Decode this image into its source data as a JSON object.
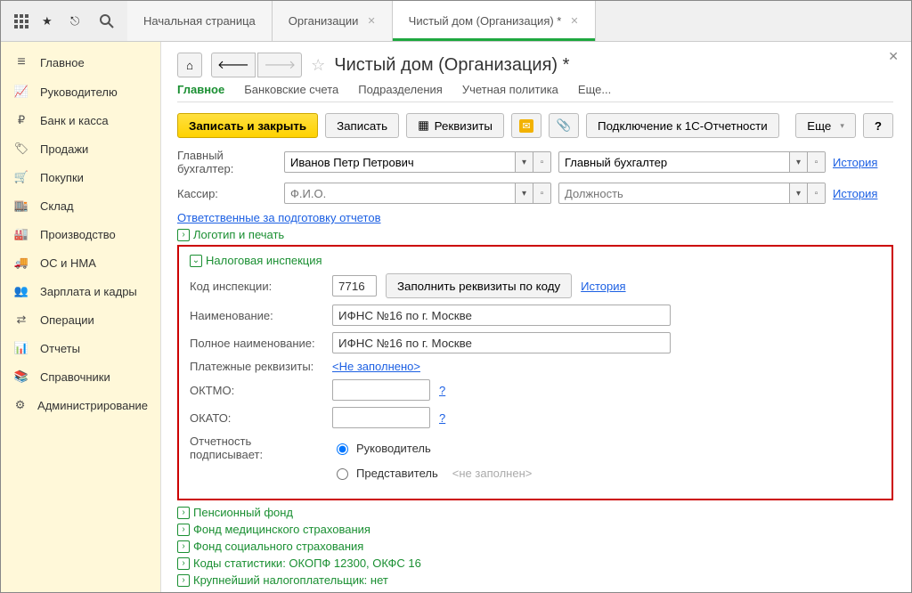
{
  "topTabs": [
    "Начальная страница",
    "Организации",
    "Чистый дом (Организация) *"
  ],
  "sidebar": [
    {
      "icon": "≡",
      "label": "Главное"
    },
    {
      "icon": "📈",
      "label": "Руководителю"
    },
    {
      "icon": "₽",
      "label": "Банк и касса"
    },
    {
      "icon": "🏷",
      "label": "Продажи"
    },
    {
      "icon": "🛒",
      "label": "Покупки"
    },
    {
      "icon": "🏬",
      "label": "Склад"
    },
    {
      "icon": "🏭",
      "label": "Производство"
    },
    {
      "icon": "🚚",
      "label": "ОС и НМА"
    },
    {
      "icon": "👥",
      "label": "Зарплата и кадры"
    },
    {
      "icon": "⇄",
      "label": "Операции"
    },
    {
      "icon": "📊",
      "label": "Отчеты"
    },
    {
      "icon": "📚",
      "label": "Справочники"
    },
    {
      "icon": "⚙",
      "label": "Администрирование"
    }
  ],
  "pageTitle": "Чистый дом (Организация) *",
  "subTabs": [
    "Главное",
    "Банковские счета",
    "Подразделения",
    "Учетная политика",
    "Еще..."
  ],
  "toolbar": {
    "saveClose": "Записать и закрыть",
    "save": "Записать",
    "requisites": "Реквизиты",
    "connect": "Подключение к 1С-Отчетности",
    "more": "Еще",
    "help": "?"
  },
  "accountant": {
    "labelMain": "Главный бухгалтер:",
    "valueMain": "Иванов Петр Петрович",
    "position": "Главный бухгалтер",
    "historyLink": "История"
  },
  "cashier": {
    "label": "Кассир:",
    "fioPlaceholder": "Ф.И.О.",
    "posPlaceholder": "Должность",
    "historyLink": "История"
  },
  "responsibleLink": "Ответственные за подготовку отчетов",
  "logoPrint": "Логотип и печать",
  "tax": {
    "section": "Налоговая инспекция",
    "codeLabel": "Код инспекции:",
    "code": "7716",
    "fillBtn": "Заполнить реквизиты по коду",
    "history": "История",
    "nameLabel": "Наименование:",
    "name": "ИФНС №16 по г. Москве",
    "fullLabel": "Полное наименование:",
    "fullName": "ИФНС №16 по г. Москве",
    "payLabel": "Платежные реквизиты:",
    "payLink": "<Не заполнено>",
    "oktmoLabel": "ОКТМО:",
    "okatoLabel": "ОКАТО:",
    "signLabel": "Отчетность подписывает:",
    "signOpt1": "Руководитель",
    "signOpt2": "Представитель",
    "signMeta": "<не заполнен>"
  },
  "expanders": [
    "Пенсионный фонд",
    "Фонд медицинского страхования",
    "Фонд социального страхования",
    "Коды статистики: ОКОПФ 12300, ОКФС 16",
    "Крупнейший налогоплательщик: нет"
  ]
}
